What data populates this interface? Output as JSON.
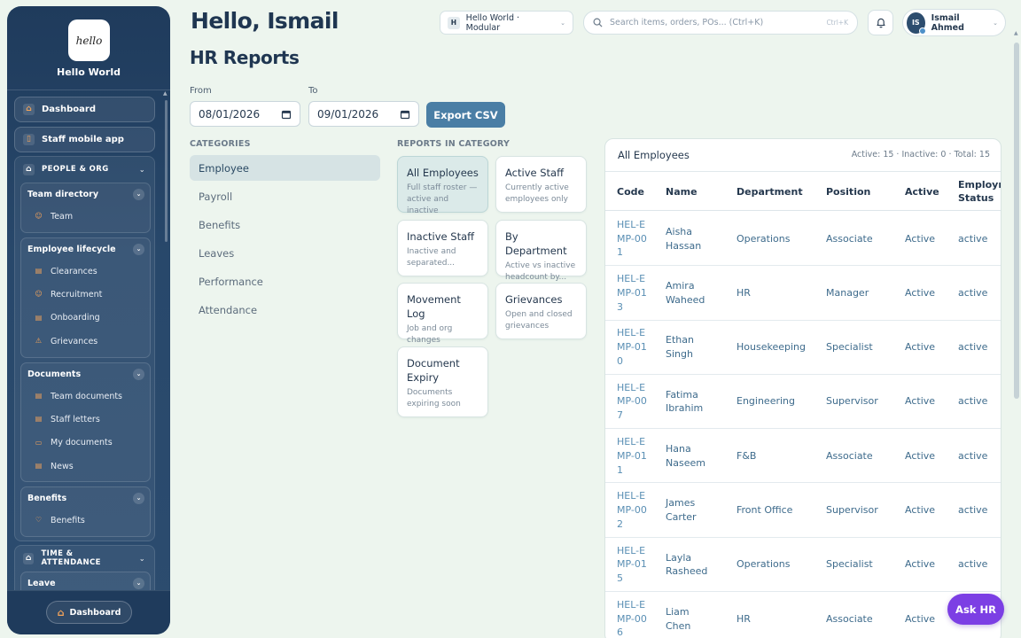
{
  "brand": {
    "logo_text": "hello",
    "name": "Hello World"
  },
  "sidebar": {
    "top_buttons": [
      {
        "label": "Dashboard"
      },
      {
        "label": "Staff mobile app"
      }
    ],
    "people_org": {
      "label": "PEOPLE & ORG",
      "team_directory": {
        "label": "Team directory",
        "items": [
          {
            "label": "Team"
          }
        ]
      },
      "employee_lifecycle": {
        "label": "Employee lifecycle",
        "items": [
          {
            "label": "Clearances"
          },
          {
            "label": "Recruitment"
          },
          {
            "label": "Onboarding"
          },
          {
            "label": "Grievances"
          }
        ]
      },
      "documents": {
        "label": "Documents",
        "items": [
          {
            "label": "Team documents"
          },
          {
            "label": "Staff letters"
          },
          {
            "label": "My documents"
          },
          {
            "label": "News"
          }
        ]
      },
      "benefits": {
        "label": "Benefits",
        "items": [
          {
            "label": "Benefits"
          }
        ]
      }
    },
    "time_attendance": {
      "label": "TIME & ATTENDANCE",
      "leave": {
        "label": "Leave"
      }
    },
    "footer_button": "Dashboard"
  },
  "header": {
    "greeting": "Hello, Ismail",
    "workspace": {
      "badge": "H",
      "label": "Hello World · Modular"
    },
    "search": {
      "placeholder": "Search items, orders, POs... (Ctrl+K)",
      "shortcut": "Ctrl+K"
    },
    "user": {
      "initials": "IS",
      "name": "Ismail Ahmed"
    }
  },
  "page": {
    "title": "HR Reports",
    "from_label": "From",
    "to_label": "To",
    "from_value": "08/01/2026",
    "to_value": "09/01/2026",
    "export_label": "Export CSV"
  },
  "categories": {
    "heading": "CATEGORIES",
    "items": [
      {
        "label": "Employee"
      },
      {
        "label": "Payroll"
      },
      {
        "label": "Benefits"
      },
      {
        "label": "Leaves"
      },
      {
        "label": "Performance"
      },
      {
        "label": "Attendance"
      }
    ]
  },
  "reports": {
    "heading": "REPORTS IN CATEGORY",
    "items": [
      {
        "title": "All Employees",
        "desc": "Full staff roster — active and inactive"
      },
      {
        "title": "Active Staff",
        "desc": "Currently active employees only"
      },
      {
        "title": "Inactive Staff",
        "desc": "Inactive and separated..."
      },
      {
        "title": "By Department",
        "desc": "Active vs inactive headcount by..."
      },
      {
        "title": "Movement Log",
        "desc": "Job and org changes"
      },
      {
        "title": "Grievances",
        "desc": "Open and closed grievances"
      },
      {
        "title": "Document Expiry",
        "desc": "Documents expiring soon"
      }
    ]
  },
  "table": {
    "title": "All Employees",
    "stats": "Active: 15 · Inactive: 0 · Total: 15",
    "columns": [
      "Code",
      "Name",
      "Department",
      "Position",
      "Active",
      "Employment Status"
    ],
    "rows": [
      {
        "code": "HEL-EMP-001",
        "name": "Aisha Hassan",
        "department": "Operations",
        "position": "Associate",
        "active": "Active",
        "status": "active"
      },
      {
        "code": "HEL-EMP-013",
        "name": "Amira Waheed",
        "department": "HR",
        "position": "Manager",
        "active": "Active",
        "status": "active"
      },
      {
        "code": "HEL-EMP-010",
        "name": "Ethan Singh",
        "department": "Housekeeping",
        "position": "Specialist",
        "active": "Active",
        "status": "active"
      },
      {
        "code": "HEL-EMP-007",
        "name": "Fatima Ibrahim",
        "department": "Engineering",
        "position": "Supervisor",
        "active": "Active",
        "status": "active"
      },
      {
        "code": "HEL-EMP-011",
        "name": "Hana Naseem",
        "department": "F&B",
        "position": "Associate",
        "active": "Active",
        "status": "active"
      },
      {
        "code": "HEL-EMP-002",
        "name": "James Carter",
        "department": "Front Office",
        "position": "Supervisor",
        "active": "Active",
        "status": "active"
      },
      {
        "code": "HEL-EMP-015",
        "name": "Layla Rasheed",
        "department": "Operations",
        "position": "Specialist",
        "active": "Active",
        "status": "active"
      },
      {
        "code": "HEL-EMP-006",
        "name": "Liam Chen",
        "department": "HR",
        "position": "Associate",
        "active": "Active",
        "status": ""
      }
    ]
  },
  "ask_hr": "Ask HR",
  "colors": {
    "sidebar": "#1f3b5c",
    "accent": "#4a7ea5",
    "ask_hr": "#7c3fe4",
    "background": "#edf5ee"
  }
}
